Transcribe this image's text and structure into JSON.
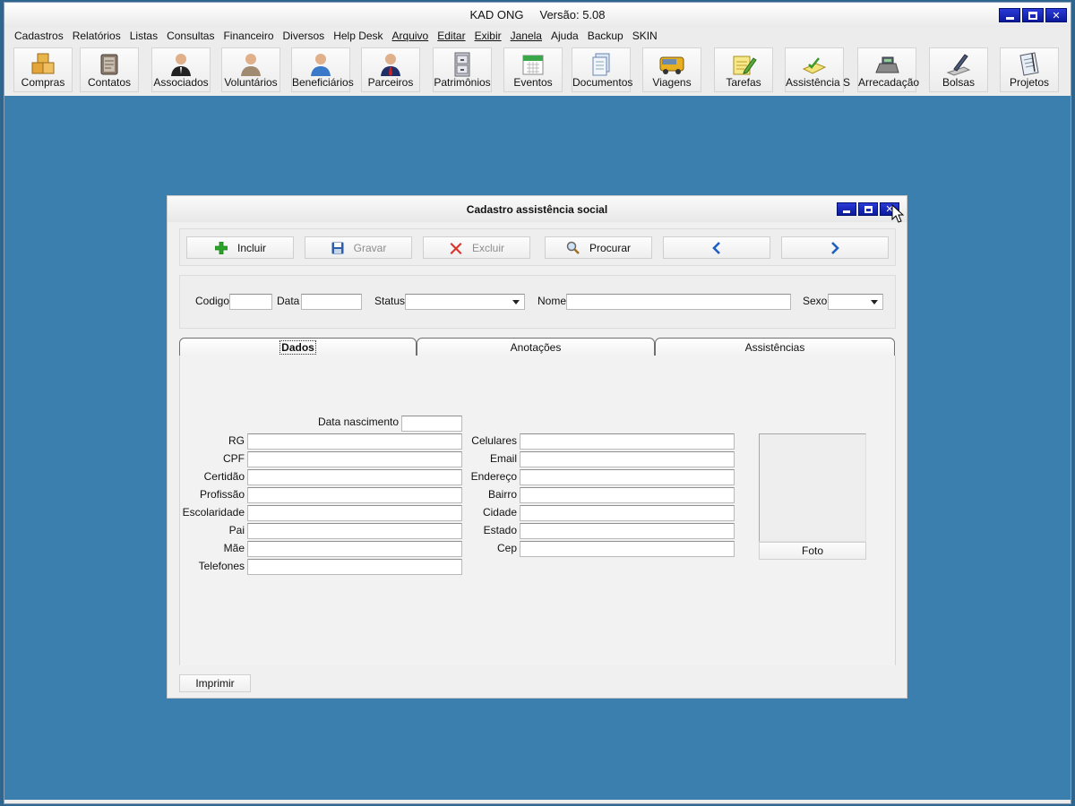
{
  "app": {
    "title": "KAD ONG     Versão: 5.08"
  },
  "menu": [
    {
      "label": "Cadastros",
      "underline": false
    },
    {
      "label": "Relatórios",
      "underline": false
    },
    {
      "label": "Listas",
      "underline": false
    },
    {
      "label": "Consultas",
      "underline": false
    },
    {
      "label": "Financeiro",
      "underline": false
    },
    {
      "label": "Diversos",
      "underline": false
    },
    {
      "label": "Help Desk",
      "underline": false
    },
    {
      "label": "Arquivo",
      "underline": true
    },
    {
      "label": "Editar",
      "underline": true
    },
    {
      "label": "Exibir",
      "underline": true
    },
    {
      "label": "Janela",
      "underline": true
    },
    {
      "label": "Ajuda",
      "underline": false
    },
    {
      "label": "Backup",
      "underline": false
    },
    {
      "label": "SKIN",
      "underline": false
    }
  ],
  "toolbar": [
    {
      "label": "Compras",
      "icon": "boxes-icon"
    },
    {
      "label": "Contatos",
      "icon": "address-book-icon"
    },
    {
      "label": "Associados",
      "icon": "person-suit-icon"
    },
    {
      "label": "Voluntários",
      "icon": "person-icon"
    },
    {
      "label": "Beneficiários",
      "icon": "person-blue-icon"
    },
    {
      "label": "Parceiros",
      "icon": "person-red-tie-icon"
    },
    {
      "label": "Patrimônios",
      "icon": "file-cabinet-icon"
    },
    {
      "label": "Eventos",
      "icon": "calendar-icon"
    },
    {
      "label": "Documentos",
      "icon": "documents-icon"
    },
    {
      "label": "Viagens",
      "icon": "bus-icon"
    },
    {
      "label": "Tarefas",
      "icon": "notepad-pencil-icon"
    },
    {
      "label": "Assistência S",
      "icon": "checklist-icon"
    },
    {
      "label": "Arrecadação",
      "icon": "cash-register-icon"
    },
    {
      "label": "Bolsas",
      "icon": "pen-icon"
    },
    {
      "label": "Projetos",
      "icon": "blueprint-icon"
    }
  ],
  "child": {
    "title": "Cadastro assistência social",
    "actions": {
      "incluir": "Incluir",
      "gravar": "Gravar",
      "excluir": "Excluir",
      "procurar": "Procurar"
    },
    "header_fields": {
      "codigo_label": "Codigo",
      "codigo_value": "",
      "data_label": "Data",
      "data_value": "",
      "status_label": "Status",
      "status_value": "",
      "nome_label": "Nome",
      "nome_value": "",
      "sexo_label": "Sexo",
      "sexo_value": ""
    },
    "tabs": [
      "Dados",
      "Anotações",
      "Assistências"
    ],
    "active_tab": "Dados",
    "dados": {
      "nascimento_label": "Data nascimento",
      "left_labels": [
        "RG",
        "CPF",
        "Certidão",
        "Profissão",
        "Escolaridade",
        "Pai",
        "Mãe",
        "Telefones"
      ],
      "right_labels": [
        "Celulares",
        "Email",
        "Endereço",
        "Bairro",
        "Cidade",
        "Estado",
        "Cep"
      ],
      "foto_button": "Foto"
    },
    "print_button": "Imprimir"
  },
  "colors": {
    "desktop": "#3a7fad",
    "title_buttons": "#1a2bbd"
  }
}
